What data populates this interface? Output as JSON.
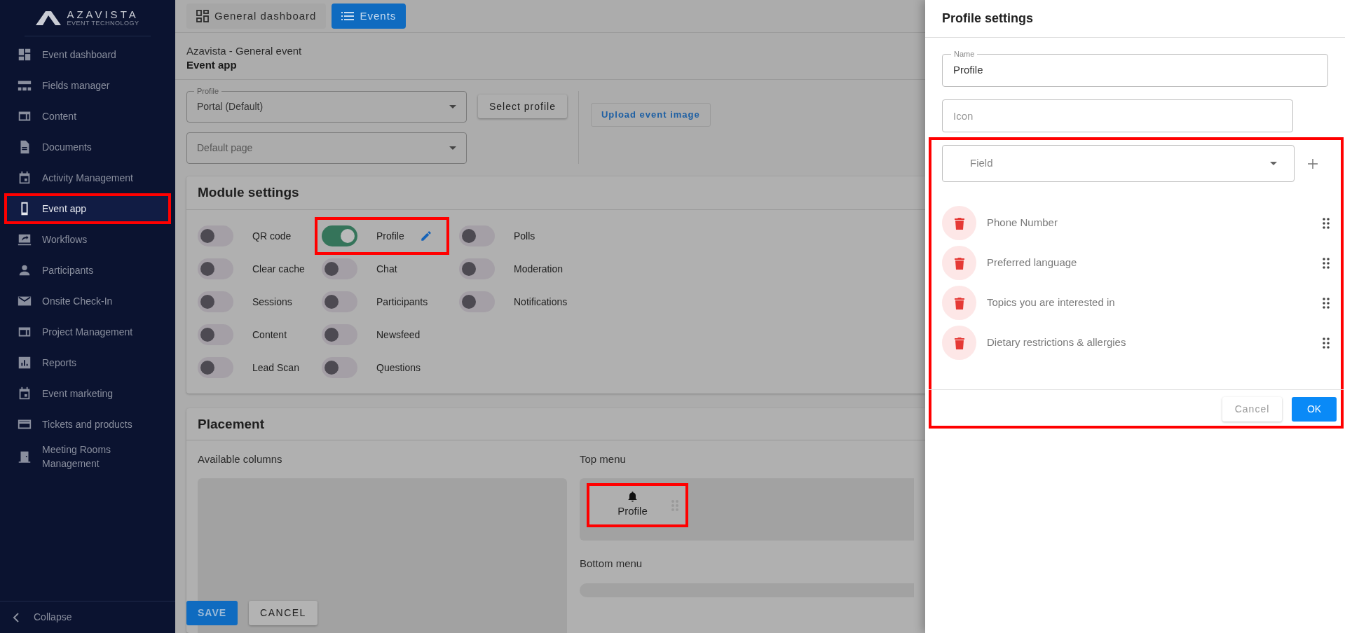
{
  "sidebar": {
    "logo": {
      "name": "AZAVISTA",
      "tagline": "EVENT TECHNOLOGY"
    },
    "items": [
      {
        "label": "Event dashboard",
        "selected": false,
        "highlighted": false
      },
      {
        "label": "Fields manager",
        "selected": false,
        "highlighted": false
      },
      {
        "label": "Content",
        "selected": false,
        "highlighted": false
      },
      {
        "label": "Documents",
        "selected": false,
        "highlighted": false
      },
      {
        "label": "Activity Management",
        "selected": false,
        "highlighted": false
      },
      {
        "label": "Event app",
        "selected": true,
        "highlighted": true
      },
      {
        "label": "Workflows",
        "selected": false,
        "highlighted": false
      },
      {
        "label": "Participants",
        "selected": false,
        "highlighted": false
      },
      {
        "label": "Onsite Check-In",
        "selected": false,
        "highlighted": false
      },
      {
        "label": "Project Management",
        "selected": false,
        "highlighted": false
      },
      {
        "label": "Reports",
        "selected": false,
        "highlighted": false
      },
      {
        "label": "Event marketing",
        "selected": false,
        "highlighted": false
      },
      {
        "label": "Tickets and products",
        "selected": false,
        "highlighted": false
      },
      {
        "label": "Meeting Rooms Management",
        "selected": false,
        "highlighted": false
      }
    ],
    "collapse": "Collapse"
  },
  "tabs": [
    {
      "label": "General dashboard",
      "selected": false
    },
    {
      "label": "Events",
      "selected": true
    }
  ],
  "breadcrumb": {
    "event": "Azavista - General event",
    "page": "Event app"
  },
  "profile_select": {
    "label": "Profile",
    "value": "Portal (Default)"
  },
  "select_profile_button": "Select profile",
  "upload_button": "Upload event image",
  "default_page_select": {
    "placeholder": "Default page"
  },
  "module_settings": {
    "title": "Module settings",
    "columns": [
      [
        {
          "label": "QR code",
          "on": false,
          "editable": false,
          "highlighted": false
        },
        {
          "label": "Clear cache",
          "on": false,
          "editable": false,
          "highlighted": false
        },
        {
          "label": "Sessions",
          "on": false,
          "editable": false,
          "highlighted": false
        },
        {
          "label": "Content",
          "on": false,
          "editable": false,
          "highlighted": false
        },
        {
          "label": "Lead Scan",
          "on": false,
          "editable": false,
          "highlighted": false
        }
      ],
      [
        {
          "label": "Profile",
          "on": true,
          "editable": true,
          "highlighted": true
        },
        {
          "label": "Chat",
          "on": false,
          "editable": false,
          "highlighted": false
        },
        {
          "label": "Participants",
          "on": false,
          "editable": false,
          "highlighted": false
        },
        {
          "label": "Newsfeed",
          "on": false,
          "editable": false,
          "highlighted": false
        },
        {
          "label": "Questions",
          "on": false,
          "editable": false,
          "highlighted": false
        }
      ],
      [
        {
          "label": "Polls",
          "on": false,
          "editable": false,
          "highlighted": false
        },
        {
          "label": "Moderation",
          "on": false,
          "editable": false,
          "highlighted": false
        },
        {
          "label": "Notifications",
          "on": false,
          "editable": false,
          "highlighted": false
        }
      ]
    ]
  },
  "placement": {
    "title": "Placement",
    "available_label": "Available columns",
    "top_menu_label": "Top menu",
    "top_menu_items": [
      {
        "label": "Profile",
        "highlighted": true
      }
    ],
    "bottom_menu_label": "Bottom menu"
  },
  "footer_buttons": {
    "save": "SAVE",
    "cancel": "CANCEL"
  },
  "drawer": {
    "title": "Profile settings",
    "name_field": {
      "label": "Name",
      "value": "Profile"
    },
    "icon_field": {
      "placeholder": "Icon"
    },
    "field_section": {
      "highlighted": true,
      "select_placeholder": "Field",
      "fields": [
        "Phone Number",
        "Preferred language",
        "Topics you are interested in",
        "Dietary restrictions & allergies"
      ]
    },
    "cancel": "Cancel",
    "ok": "OK"
  }
}
